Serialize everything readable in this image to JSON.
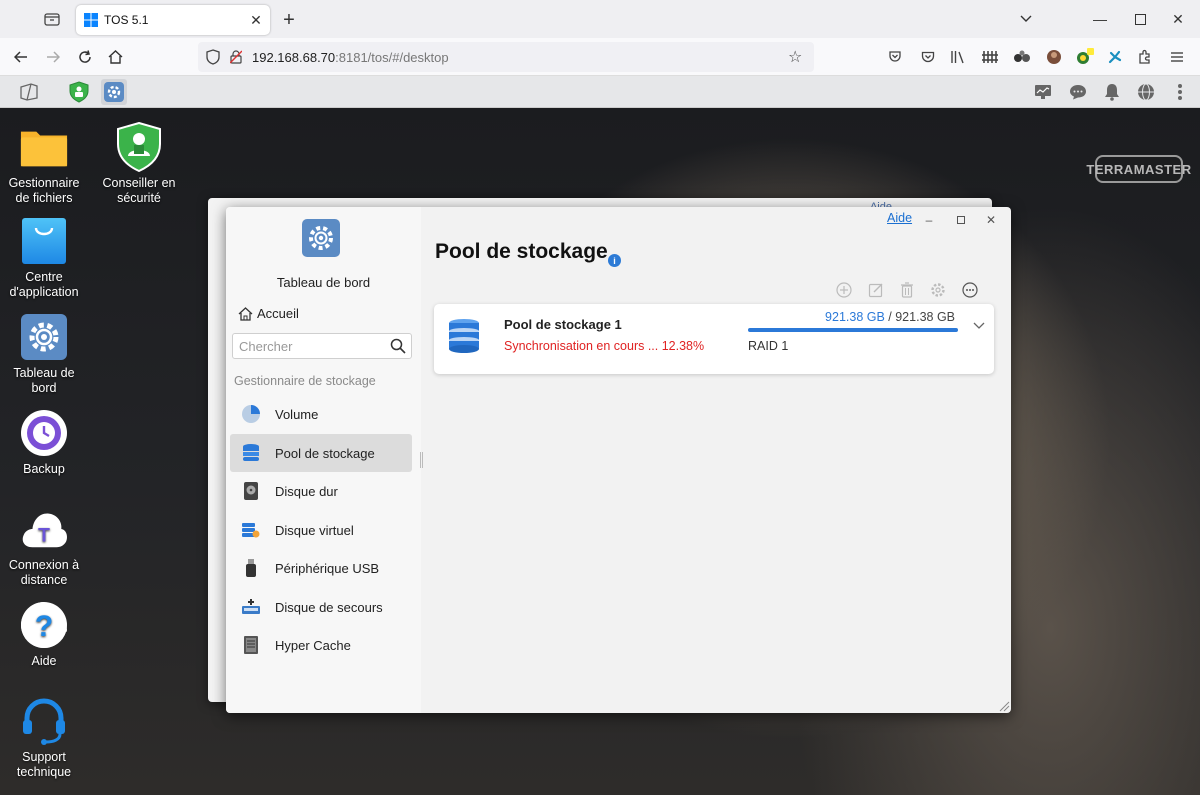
{
  "browser": {
    "tab_title": "TOS 5.1",
    "url_host": "192.168.68.70",
    "url_rest": ":8181/tos/#/desktop"
  },
  "desktop": {
    "brand": "TERRAMASTER",
    "icons": [
      {
        "label_line1": "Gestionnaire",
        "label_line2": "de fichiers"
      },
      {
        "label_line1": "Conseiller en",
        "label_line2": "sécurité"
      },
      {
        "label_line1": "Centre",
        "label_line2": "d'application"
      },
      {
        "label_line1": "Tableau de",
        "label_line2": "bord"
      },
      {
        "label_line1": "Backup",
        "label_line2": ""
      },
      {
        "label_line1": "Connexion à",
        "label_line2": "distance"
      },
      {
        "label_line1": "Aide",
        "label_line2": ""
      },
      {
        "label_line1": "Support",
        "label_line2": "technique"
      }
    ]
  },
  "back_window": {
    "help_link": "Aide"
  },
  "window": {
    "help_link": "Aide",
    "sidebar": {
      "app_title": "Tableau de bord",
      "home": "Accueil",
      "search_placeholder": "Chercher",
      "section": "Gestionnaire de stockage",
      "items": [
        {
          "label": "Volume",
          "icon": "volume-pie-icon"
        },
        {
          "label": "Pool de stockage",
          "icon": "storage-pool-icon",
          "selected": true
        },
        {
          "label": "Disque dur",
          "icon": "hard-disk-icon"
        },
        {
          "label": "Disque virtuel",
          "icon": "virtual-disk-icon"
        },
        {
          "label": "Périphérique USB",
          "icon": "usb-icon"
        },
        {
          "label": "Disque de secours",
          "icon": "spare-disk-icon"
        },
        {
          "label": "Hyper Cache",
          "icon": "hyper-cache-icon"
        }
      ]
    },
    "main": {
      "title": "Pool de stockage",
      "pool": {
        "name": "Pool de stockage 1",
        "status": "Synchronisation en cours ... 12.38%",
        "used": "921.38 GB",
        "separator": " / ",
        "total": "921.38 GB",
        "usage_fraction": 1.0,
        "raid": "RAID 1"
      }
    }
  },
  "colors": {
    "accent": "#2b79d8",
    "error": "#e02323",
    "shield_green": "#3bb34a"
  }
}
